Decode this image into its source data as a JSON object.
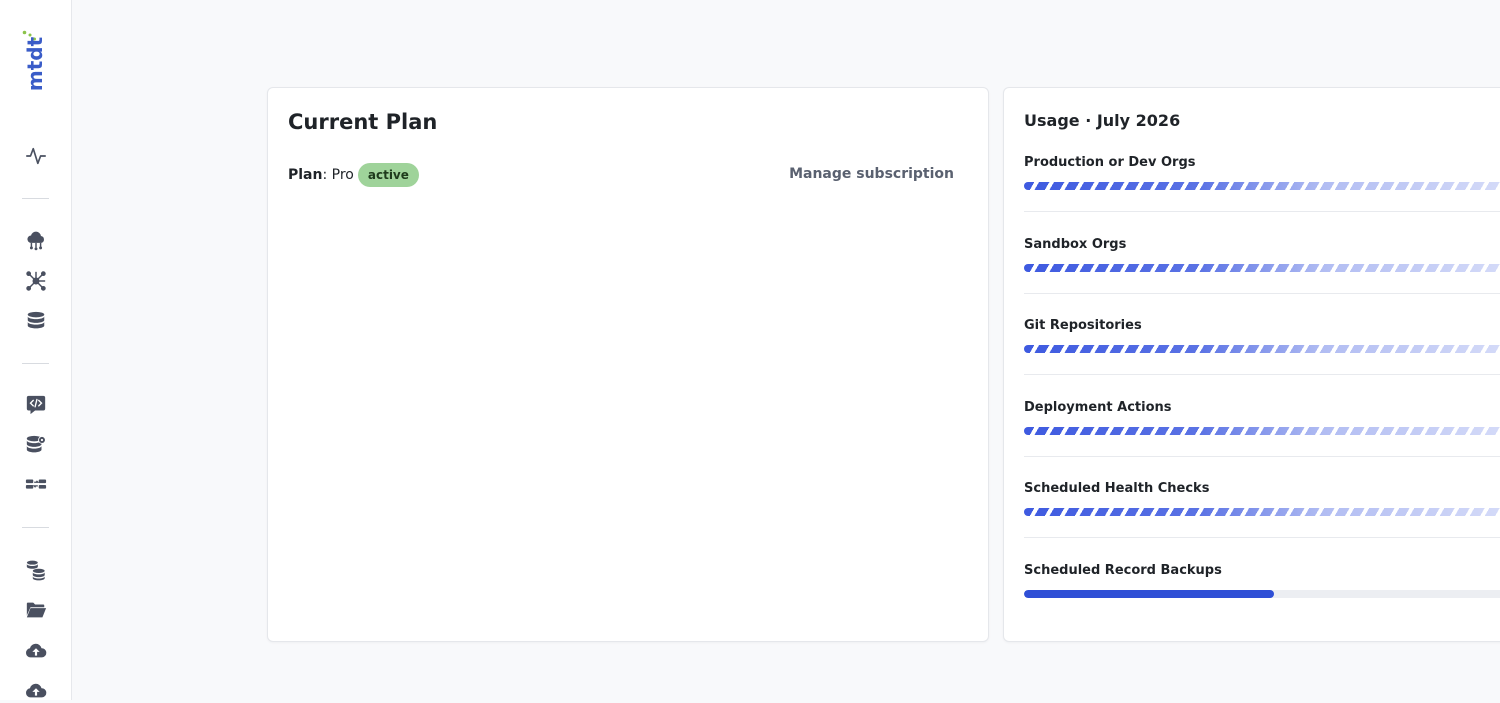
{
  "app": {
    "logo_text": "mtdt"
  },
  "sidebar": {
    "icons": [
      "activity-icon",
      "cloud-network-icon",
      "graph-nodes-icon",
      "database-icon",
      "code-chat-icon",
      "database-settings-icon",
      "compare-databases-icon",
      "database-stack-icon",
      "folder-open-icon",
      "cloud-upload-icon",
      "cloud-upload-icon"
    ]
  },
  "plan": {
    "title": "Current Plan",
    "plan_key": "Plan",
    "plan_sep": ": ",
    "plan_value": "Pro",
    "status": "active",
    "manage_link": "Manage subscription"
  },
  "usage": {
    "title": "Usage · July 2026",
    "items": [
      {
        "label": "Production or Dev Orgs",
        "display": "unlimited"
      },
      {
        "label": "Sandbox Orgs",
        "display": "unlimited"
      },
      {
        "label": "Git Repositories",
        "display": "unlimited"
      },
      {
        "label": "Deployment Actions",
        "display": "unlimited"
      },
      {
        "label": "Scheduled Health Checks",
        "display": "unlimited"
      },
      {
        "label": "Scheduled Record Backups",
        "display": "progress",
        "progress": 0.5
      }
    ]
  },
  "colors": {
    "accent": "#3a5cc8",
    "bar_fill": "#2f4fd6",
    "badge_bg": "#9fd39a",
    "logo_dot": "#8bc34a"
  }
}
